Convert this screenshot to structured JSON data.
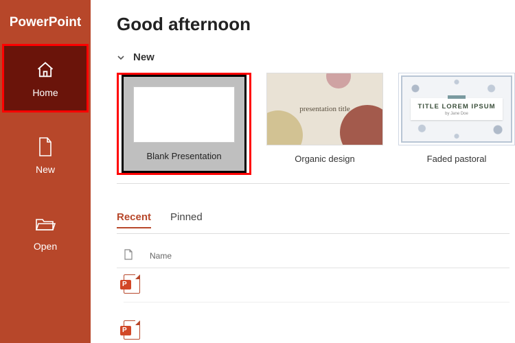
{
  "app_title": "PowerPoint",
  "sidebar": {
    "items": [
      {
        "label": "Home",
        "icon": "home-icon",
        "selected": true
      },
      {
        "label": "New",
        "icon": "new-doc-icon",
        "selected": false
      },
      {
        "label": "Open",
        "icon": "open-folder-icon",
        "selected": false
      }
    ]
  },
  "main": {
    "greeting": "Good afternoon",
    "new_section_label": "New",
    "templates": [
      {
        "name": "Blank Presentation",
        "selected": true
      },
      {
        "name": "Organic design",
        "thumb_text": "presentation title",
        "selected": false
      },
      {
        "name": "Faded pastoral",
        "thumb_text": "TITLE LOREM IPSUM",
        "thumb_sub": "by Jane Doe",
        "selected": false
      }
    ],
    "tabs": [
      {
        "label": "Recent",
        "active": true
      },
      {
        "label": "Pinned",
        "active": false
      }
    ],
    "list": {
      "col_name": "Name",
      "rows": [
        {
          "type": "pptx"
        },
        {
          "type": "pptx"
        }
      ]
    }
  }
}
